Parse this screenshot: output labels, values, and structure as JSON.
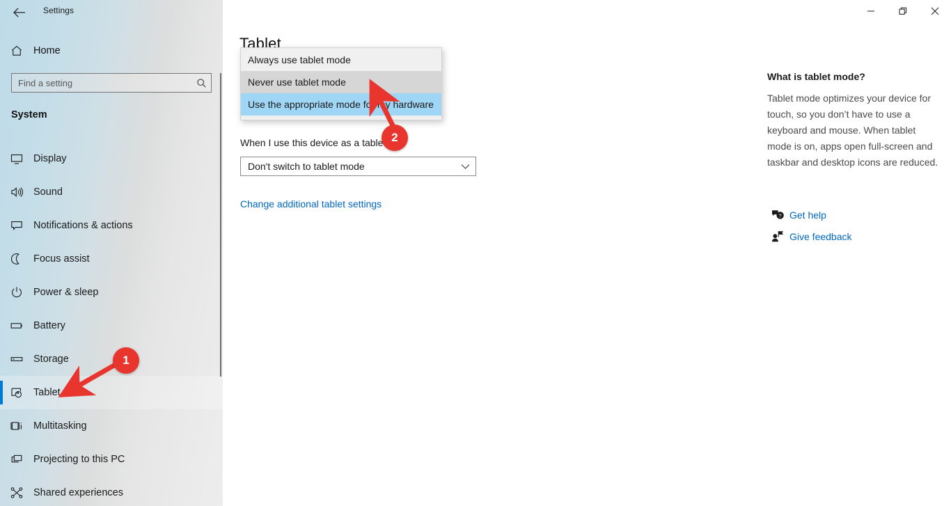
{
  "window": {
    "title": "Settings",
    "back_icon": "back-arrow-icon",
    "controls": {
      "minimize": "minimize-icon",
      "restore": "restore-icon",
      "close": "close-icon"
    }
  },
  "sidebar": {
    "home": {
      "label": "Home",
      "icon": "home-icon"
    },
    "search": {
      "placeholder": "Find a setting",
      "value": "",
      "icon": "search-icon"
    },
    "group_title": "System",
    "items": [
      {
        "label": "Display",
        "icon": "monitor-icon",
        "selected": false
      },
      {
        "label": "Sound",
        "icon": "speaker-icon",
        "selected": false
      },
      {
        "label": "Notifications & actions",
        "icon": "notification-icon",
        "selected": false
      },
      {
        "label": "Focus assist",
        "icon": "moon-icon",
        "selected": false
      },
      {
        "label": "Power & sleep",
        "icon": "power-icon",
        "selected": false
      },
      {
        "label": "Battery",
        "icon": "battery-icon",
        "selected": false
      },
      {
        "label": "Storage",
        "icon": "storage-icon",
        "selected": false
      },
      {
        "label": "Tablet",
        "icon": "tablet-hand-icon",
        "selected": true
      },
      {
        "label": "Multitasking",
        "icon": "multitasking-icon",
        "selected": false
      },
      {
        "label": "Projecting to this PC",
        "icon": "projecting-icon",
        "selected": false
      },
      {
        "label": "Shared experiences",
        "icon": "share-nodes-icon",
        "selected": false
      }
    ]
  },
  "main": {
    "page_title": "Tablet",
    "open_dropdown": {
      "options": [
        {
          "label": "Always use tablet mode",
          "state": "normal"
        },
        {
          "label": "Never use tablet mode",
          "state": "hover"
        },
        {
          "label": "Use the appropriate mode for my hardware",
          "state": "selected"
        }
      ]
    },
    "device_field": {
      "label": "When I use this device as a tablet",
      "value": "Don't switch to tablet mode",
      "chevron_icon": "chevron-down-icon"
    },
    "additional_link": "Change additional tablet settings"
  },
  "help_panel": {
    "title": "What is tablet mode?",
    "body": "Tablet mode optimizes your device for touch, so you don’t have to use a keyboard and mouse. When tablet mode is on, apps open full-screen and taskbar and desktop icons are reduced.",
    "links": [
      {
        "label": "Get help",
        "icon": "help-bubble-icon"
      },
      {
        "label": "Give feedback",
        "icon": "feedback-person-icon"
      }
    ]
  },
  "annotations": {
    "color": "#e8352e",
    "markers": [
      {
        "number": "1",
        "points_to": "sidebar-item-tablet"
      },
      {
        "number": "2",
        "points_to": "dropdown-option-never-use-tablet-mode"
      }
    ]
  }
}
